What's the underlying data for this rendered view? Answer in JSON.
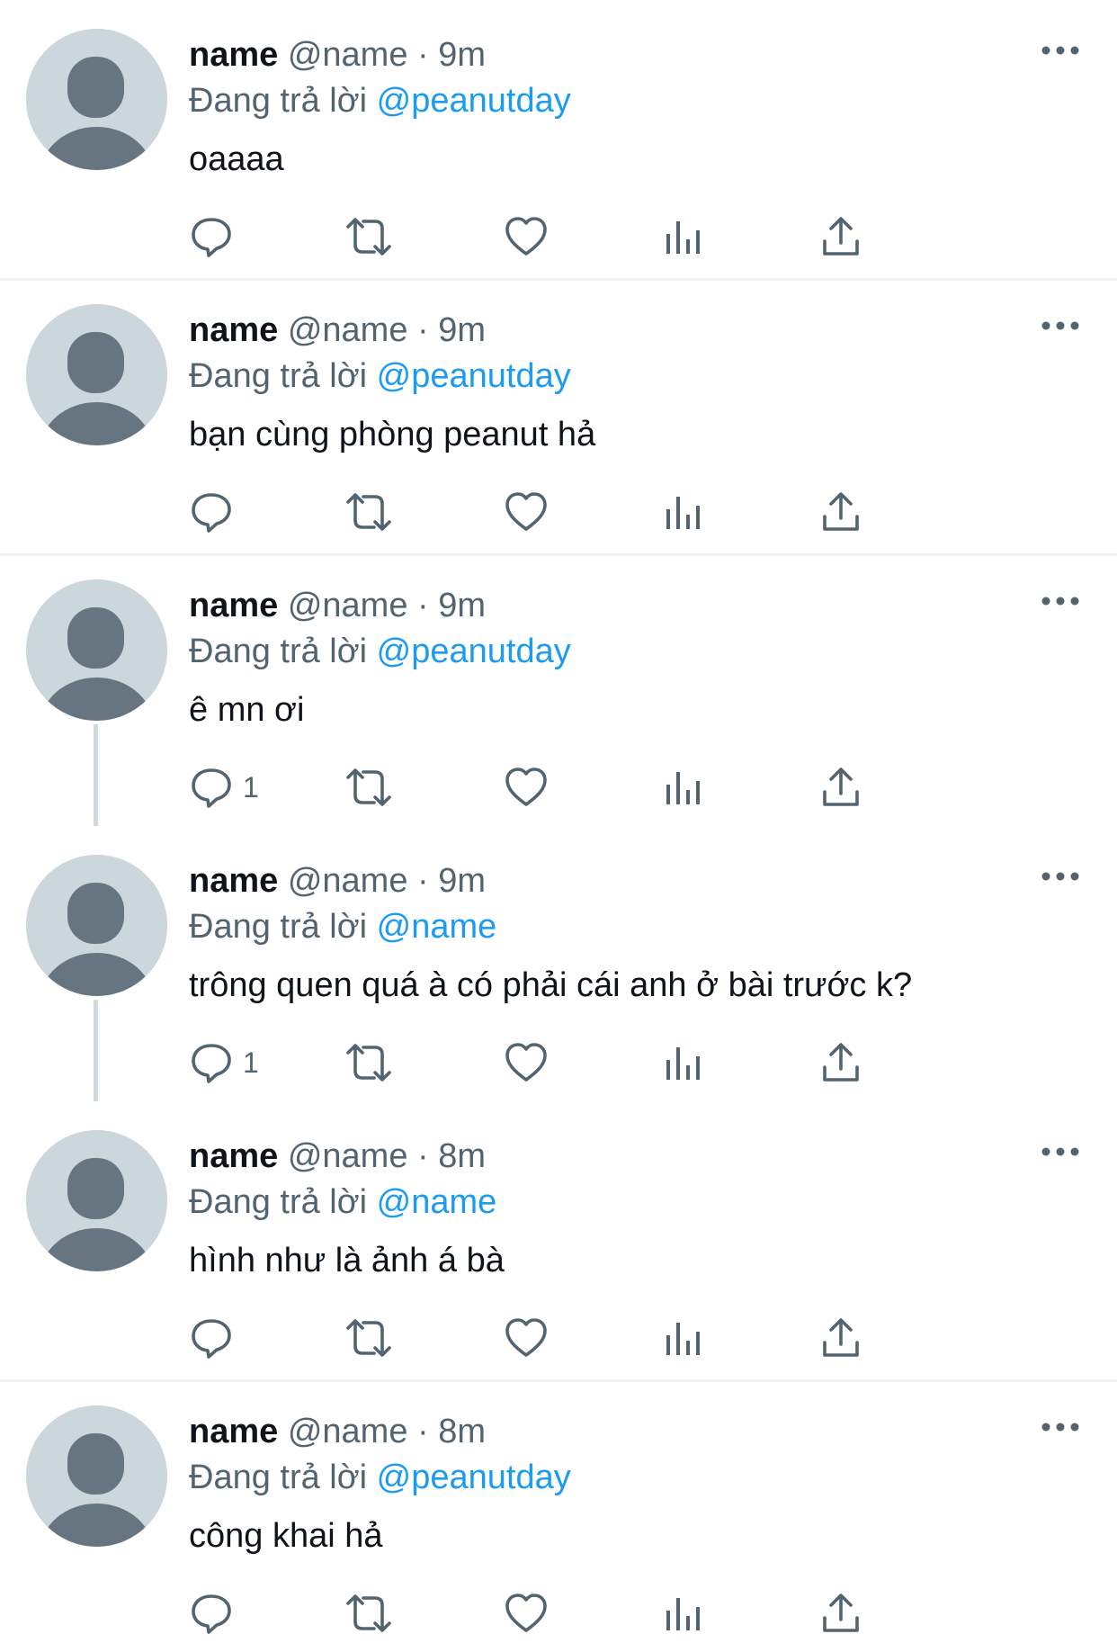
{
  "colors": {
    "link": "#1d9bf0",
    "secondary_text": "#536471",
    "primary_text": "#0f1419",
    "avatar_bg": "#ccd6dd",
    "avatar_fg": "#66757f",
    "divider": "#eff3f4"
  },
  "icons": {
    "reply": "speech-bubble-icon",
    "retweet": "retweet-arrows-icon",
    "like": "heart-icon",
    "views": "bar-chart-icon",
    "share": "share-upload-icon",
    "more": "ellipsis-icon"
  },
  "tweets": [
    {
      "name": "name",
      "handle": "@name",
      "separator": "·",
      "time": "9m",
      "reply_prefix": "Đang trả lời",
      "reply_to": "@peanutday",
      "text": "oaaaa",
      "reply_count": ""
    },
    {
      "name": "name",
      "handle": "@name",
      "separator": "·",
      "time": "9m",
      "reply_prefix": "Đang trả lời",
      "reply_to": "@peanutday",
      "text": "bạn cùng phòng peanut hả",
      "reply_count": ""
    },
    {
      "name": "name",
      "handle": "@name",
      "separator": "·",
      "time": "9m",
      "reply_prefix": "Đang trả lời",
      "reply_to": "@peanutday",
      "text": "ê mn ơi",
      "reply_count": "1"
    },
    {
      "name": "name",
      "handle": "@name",
      "separator": "·",
      "time": "9m",
      "reply_prefix": "Đang trả lời",
      "reply_to": "@name",
      "text": "trông quen quá à có phải cái anh ở bài trước k?",
      "reply_count": "1"
    },
    {
      "name": "name",
      "handle": "@name",
      "separator": "·",
      "time": "8m",
      "reply_prefix": "Đang trả lời",
      "reply_to": "@name",
      "text": "hình như là ảnh á bà",
      "reply_count": ""
    },
    {
      "name": "name",
      "handle": "@name",
      "separator": "·",
      "time": "8m",
      "reply_prefix": "Đang trả lời",
      "reply_to": "@peanutday",
      "text": "công khai hả",
      "reply_count": ""
    }
  ]
}
